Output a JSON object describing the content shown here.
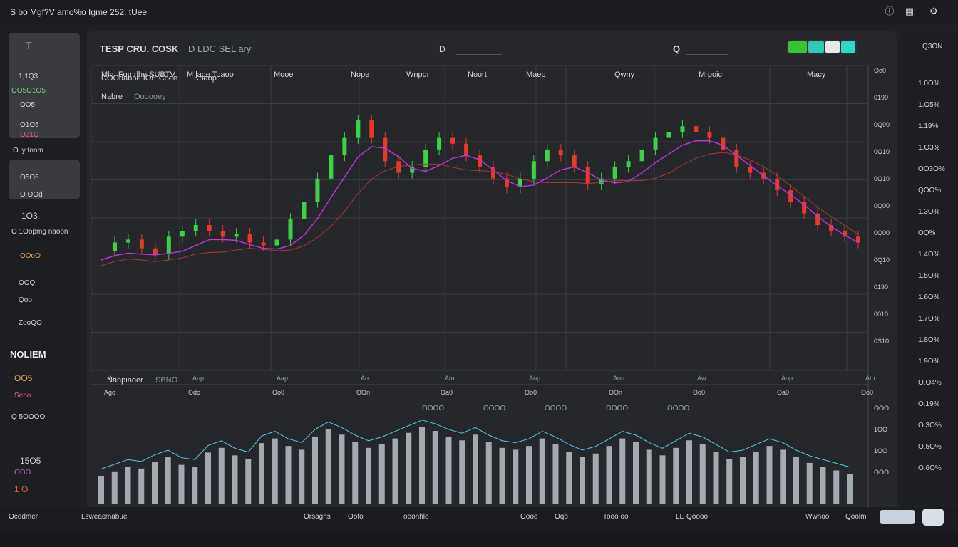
{
  "window": {
    "title": "S bo Mgf?V amo%o Igme 252. tUee",
    "icons": [
      "info-icon",
      "layout-icon",
      "settings-icon"
    ]
  },
  "header": {
    "symbol": "TESP CRU. COSK",
    "subtitle": "D LDC SEL ary",
    "field_label": "D",
    "search_label": "Q"
  },
  "chart_header": {
    "row1": [
      "Mlm Fomrlhe SUBTV",
      "M lage Toaoo",
      "Mooe",
      "Nope",
      "Wnpdr",
      "Noort",
      "Maep",
      "Qwny",
      "Mrpoic",
      "Macy"
    ],
    "row2": "COOdabne IOE Coee",
    "row2b": "Knaop",
    "row3": "Nabre",
    "row3b": "Oooooey"
  },
  "left": {
    "card1": [
      "T",
      "1,1Q3",
      "OO5O1O5",
      "OO5",
      "O1O5",
      "O21O"
    ],
    "label1": "O ly toom",
    "card2": [
      "O5O5",
      "O OOd"
    ],
    "items": [
      "1O3",
      "O 1Oopmg naoon",
      "OOoO",
      "OOQ",
      "Qoo",
      "ZooQO"
    ],
    "section": "NOLIEM",
    "items2": [
      "OO5",
      "Sebo",
      "Q 5OOOO",
      "15O5",
      "OOO",
      "1 O"
    ],
    "footer": "Ocedmer"
  },
  "x_axis": [
    "Ao",
    "Aup",
    "Aap",
    "Ao",
    "Ato",
    "Aop",
    "Aon",
    "Aw",
    "Aop",
    "Atp"
  ],
  "x_axis_lower": [
    "Ago",
    "Odo",
    "Oo0",
    "OOn",
    "Oa0",
    "Oo0",
    "OOn",
    "Oo0",
    "Oa0",
    "Oo0"
  ],
  "y_axis": [
    "Oo0",
    "0190",
    "0Q90",
    "0Q10",
    "0Q10",
    "0Q00",
    "0Q00",
    "0Q10",
    "0190",
    "0010",
    "0S10"
  ],
  "indicator_label": "Nanpinoer",
  "indicator_label_b": "SBNO",
  "indicator_legend": [
    "OOOO",
    "OOOO",
    "OOOO",
    "OOOO",
    "OOOO"
  ],
  "volume_y": [
    "OOO",
    "1OO",
    "1OO",
    "OOO"
  ],
  "bottom_left": "Lsweacmabue",
  "bottom_labels": [
    "Orsaghs",
    "Oofo",
    "oeonhle",
    "Oooe",
    "Oqo",
    "Tooo oo",
    "LE Qoooo",
    "Wwnoo",
    "Qoolm"
  ],
  "right": {
    "top": "Q3ON",
    "items": [
      "1.0O%",
      "1.O5%",
      "1.19%",
      "1.O3%",
      "OO3O%",
      "QOO%",
      "1.3O%",
      "OQ%",
      "1.4O%",
      "1.5O%",
      "1.6O%",
      "1.7O%",
      "1.8O%",
      "1.9O%",
      "O.O4%",
      "O.19%",
      "O.3O%",
      "O.5O%",
      "O.6O%"
    ]
  },
  "chart_data": {
    "type": "candlestick",
    "series": [
      {
        "name": "price",
        "values": [
          0.41,
          0.44,
          0.45,
          0.42,
          0.4,
          0.46,
          0.48,
          0.5,
          0.48,
          0.46,
          0.47,
          0.44,
          0.43,
          0.45,
          0.52,
          0.58,
          0.66,
          0.74,
          0.8,
          0.86,
          0.8,
          0.72,
          0.68,
          0.7,
          0.76,
          0.8,
          0.78,
          0.74,
          0.7,
          0.66,
          0.63,
          0.66,
          0.72,
          0.76,
          0.74,
          0.7,
          0.64,
          0.66,
          0.7,
          0.72,
          0.76,
          0.8,
          0.82,
          0.84,
          0.82,
          0.8,
          0.76,
          0.7,
          0.68,
          0.66,
          0.62,
          0.58,
          0.54,
          0.5,
          0.48,
          0.46,
          0.44
        ]
      }
    ],
    "volume": [
      0.3,
      0.35,
      0.4,
      0.38,
      0.45,
      0.5,
      0.42,
      0.4,
      0.55,
      0.6,
      0.52,
      0.48,
      0.65,
      0.7,
      0.62,
      0.58,
      0.72,
      0.8,
      0.74,
      0.66,
      0.6,
      0.64,
      0.7,
      0.76,
      0.82,
      0.78,
      0.72,
      0.68,
      0.74,
      0.66,
      0.6,
      0.58,
      0.62,
      0.7,
      0.64,
      0.56,
      0.5,
      0.54,
      0.62,
      0.7,
      0.66,
      0.58,
      0.52,
      0.6,
      0.68,
      0.64,
      0.56,
      0.48,
      0.5,
      0.56,
      0.62,
      0.58,
      0.5,
      0.44,
      0.4,
      0.36,
      0.32
    ],
    "colors": {
      "up": "#3fd04a",
      "down": "#e23a2b",
      "ma1": "#c034e0",
      "ma2": "#a83838",
      "volume": "#b8c1c9",
      "volume_line": "#55c8e8"
    }
  }
}
